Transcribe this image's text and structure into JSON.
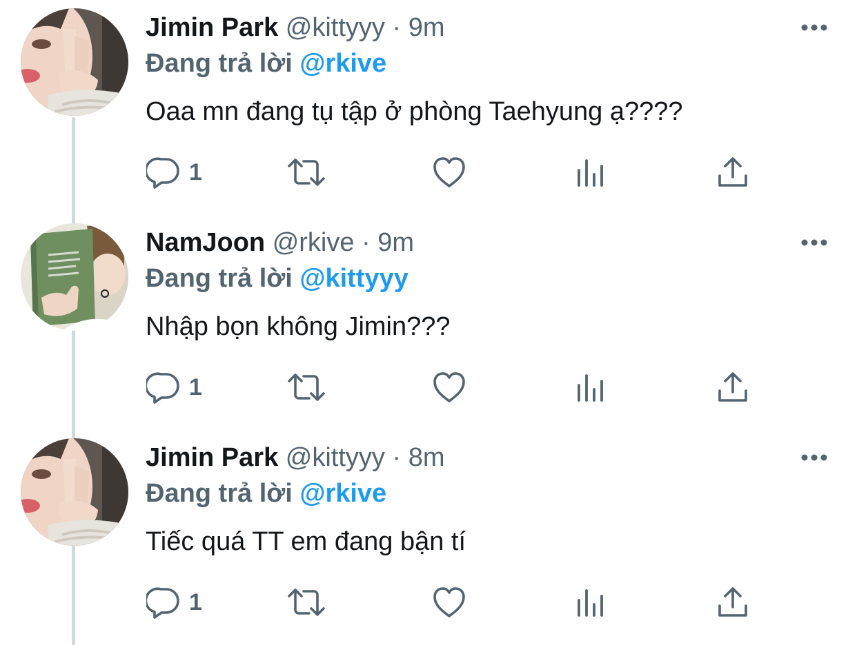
{
  "tweets": [
    {
      "name": "Jimin Park",
      "handle": "@kittyyy",
      "separator": "·",
      "time": "9m",
      "reply_prefix": "Đang trả lời",
      "reply_to": "@rkive",
      "text": "Oaa mn đang tụ tập ở phòng Taehyung ạ????",
      "reply_count": "1",
      "avatar": "jimin-avatar"
    },
    {
      "name": "NamJoon",
      "handle": "@rkive",
      "separator": "·",
      "time": "9m",
      "reply_prefix": "Đang trả lời",
      "reply_to": "@kittyyy",
      "text": "Nhập bọn không Jimin???",
      "reply_count": "1",
      "avatar": "namjoon-avatar"
    },
    {
      "name": "Jimin Park",
      "handle": "@kittyyy",
      "separator": "·",
      "time": "8m",
      "reply_prefix": "Đang trả lời",
      "reply_to": "@rkive",
      "text": "Tiếc quá TT em đang bận tí",
      "reply_count": "1",
      "avatar": "jimin-avatar"
    }
  ],
  "icons": {
    "reply": "reply-icon",
    "retweet": "retweet-icon",
    "like": "heart-icon",
    "views": "views-icon",
    "share": "share-icon",
    "more": "more-icon"
  },
  "colors": {
    "text": "#14171a",
    "muted": "#536471",
    "accent": "#1d9bf0",
    "thread_line": "#cfd9de"
  }
}
